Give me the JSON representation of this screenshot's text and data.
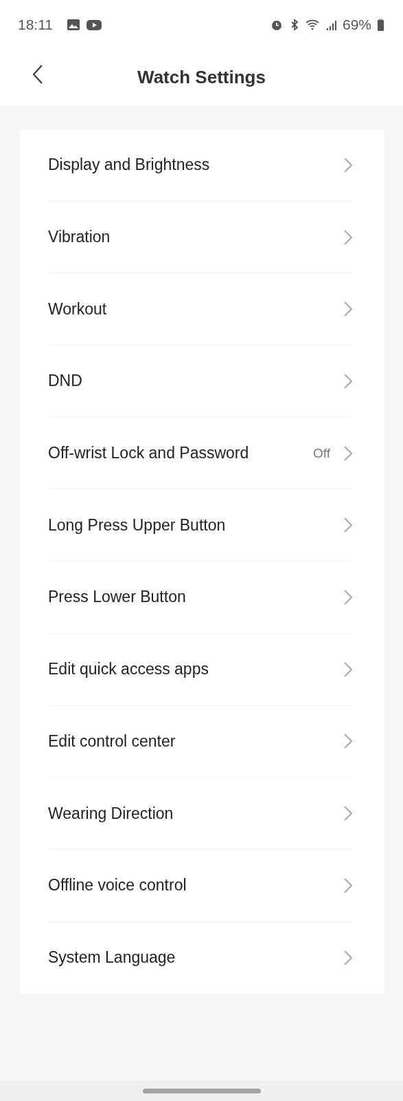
{
  "status_bar": {
    "time": "18:11",
    "battery": "69%"
  },
  "header": {
    "title": "Watch Settings"
  },
  "settings": [
    {
      "label": "Display and Brightness"
    },
    {
      "label": "Vibration"
    },
    {
      "label": "Workout"
    },
    {
      "label": "DND"
    },
    {
      "label": "Off-wrist Lock and Password",
      "value": "Off"
    },
    {
      "label": "Long Press Upper Button"
    },
    {
      "label": "Press Lower Button"
    },
    {
      "label": "Edit quick access apps"
    },
    {
      "label": "Edit control center"
    },
    {
      "label": "Wearing Direction"
    },
    {
      "label": "Offline voice control"
    },
    {
      "label": "System Language"
    }
  ]
}
